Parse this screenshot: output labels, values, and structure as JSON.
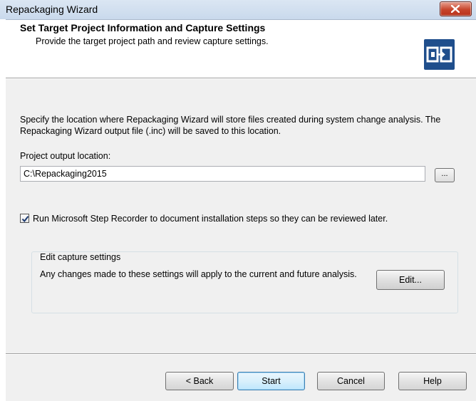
{
  "window": {
    "title": "Repackaging Wizard"
  },
  "header": {
    "title": "Set Target Project Information and Capture Settings",
    "subtitle": "Provide the target project path and review capture settings.",
    "logo_icon": "wizard-logo-icon",
    "logo_color": "#1f4e8c"
  },
  "main": {
    "description": "Specify the location where Repackaging Wizard will store files created during system change analysis. The Repackaging Wizard output file (.inc) will be saved to this location.",
    "output_label": "Project output location:",
    "output_value": "C:\\Repackaging2015",
    "browse_label": "...",
    "step_recorder": {
      "checked": true,
      "label": "Run Microsoft Step Recorder to document installation steps so they can be reviewed later."
    },
    "capture_group": {
      "title": "Edit capture settings",
      "text": "Any changes made to these settings will apply to the current and future analysis.",
      "edit_label": "Edit..."
    }
  },
  "footer": {
    "back_label": "< Back",
    "start_label": "Start",
    "cancel_label": "Cancel",
    "help_label": "Help"
  }
}
